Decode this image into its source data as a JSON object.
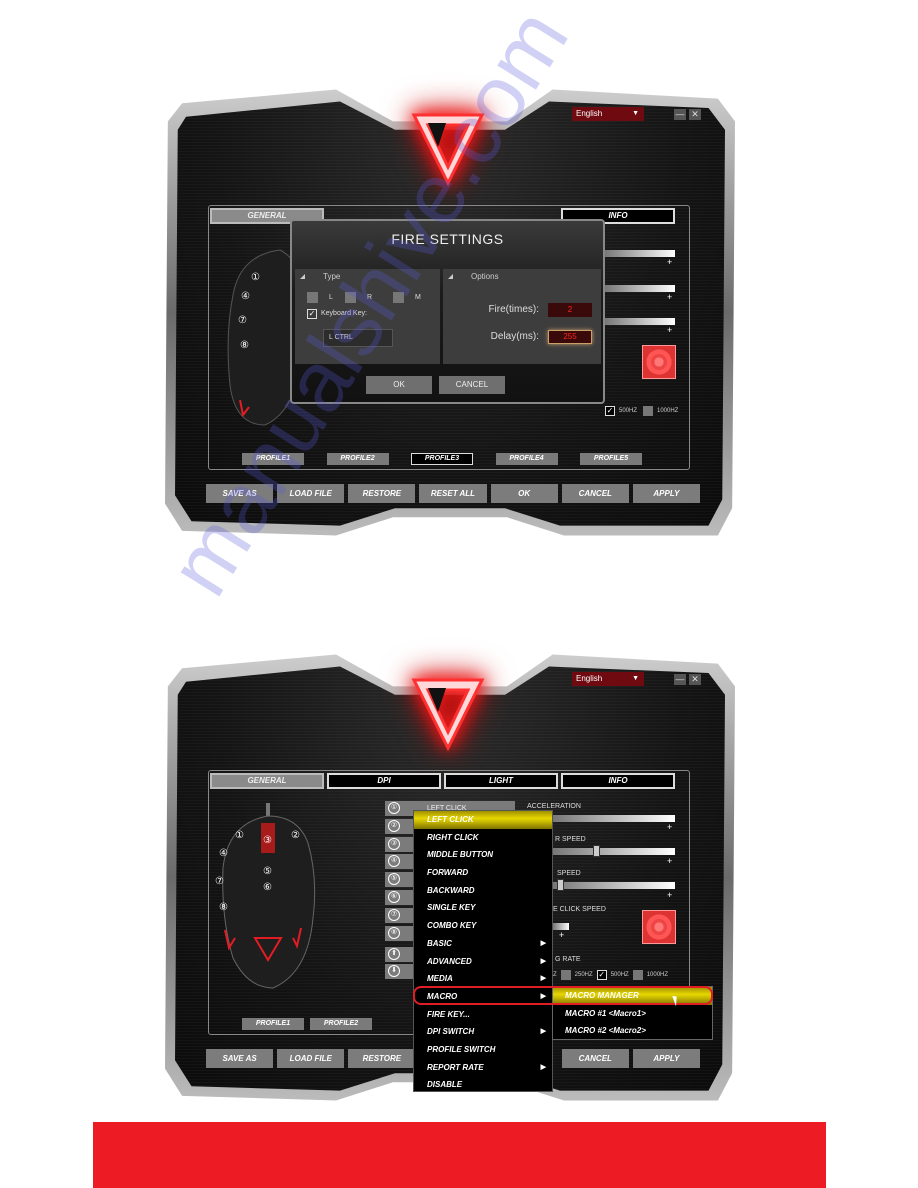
{
  "colors": {
    "accent_red": "#ed1c24",
    "menu_highlight": "#e6d600",
    "language_bg": "#6e0a10",
    "field_text_red": "#ff2222"
  },
  "watermark": "manualshive.com",
  "screenshot_top": {
    "language": "English",
    "window_controls": {
      "minimize": "—",
      "close": "✕"
    },
    "tabs": [
      {
        "label": "GENERAL",
        "active": true
      },
      {
        "label": "INFO",
        "active": false
      }
    ],
    "mouse_buttons_visible": [
      "①",
      "④",
      "⑦",
      "⑧"
    ],
    "fire_settings": {
      "title": "FIRE SETTINGS",
      "type_panel": {
        "header": "Type",
        "options": [
          {
            "label": "L",
            "checked": false
          },
          {
            "label": "R",
            "checked": false
          },
          {
            "label": "M",
            "checked": false
          }
        ],
        "keyboard_key_label": "Keyboard Key:",
        "keyboard_key_checked": true,
        "keyboard_key_value": "L CTRL"
      },
      "options_panel": {
        "header": "Options",
        "fire_times_label": "Fire(times):",
        "fire_times_value": "2",
        "delay_label": "Delay(ms):",
        "delay_value": "255"
      },
      "ok_label": "OK",
      "cancel_label": "CANCEL"
    },
    "report_rate": [
      {
        "label": "500HZ",
        "checked": true
      },
      {
        "label": "1000HZ",
        "checked": false
      }
    ],
    "profiles": [
      {
        "label": "PROFILE1",
        "active": false
      },
      {
        "label": "PROFILE2",
        "active": false
      },
      {
        "label": "PROFILE3",
        "active": true
      },
      {
        "label": "PROFILE4",
        "active": false
      },
      {
        "label": "PROFILE5",
        "active": false
      }
    ],
    "actions": [
      "SAVE AS",
      "LOAD FILE",
      "RESTORE",
      "RESET ALL",
      "OK",
      "CANCEL",
      "APPLY"
    ]
  },
  "screenshot_bottom": {
    "language": "English",
    "window_controls": {
      "minimize": "—",
      "close": "✕"
    },
    "tabs": [
      {
        "label": "GENERAL",
        "active": true
      },
      {
        "label": "DPI",
        "active": false
      },
      {
        "label": "LIGHT",
        "active": false
      },
      {
        "label": "INFO",
        "active": false
      }
    ],
    "mouse_labels": [
      "①",
      "②",
      "③",
      "④",
      "⑤",
      "⑥",
      "⑦",
      "⑧"
    ],
    "button_list": [
      {
        "num": "①",
        "label": "LEFT CLICK"
      },
      {
        "num": "②",
        "label": ""
      },
      {
        "num": "③",
        "label": ""
      },
      {
        "num": "④",
        "label": ""
      },
      {
        "num": "⑤",
        "label": ""
      },
      {
        "num": "⑥",
        "label": ""
      },
      {
        "num": "⑦",
        "label": ""
      },
      {
        "num": "⑧",
        "label": ""
      },
      {
        "num": "⬆",
        "label": ""
      },
      {
        "num": "⬇",
        "label": ""
      }
    ],
    "settings": {
      "acceleration_label": "ACCELERATION",
      "pointer_speed_label": "R SPEED",
      "scroll_speed_label": "SPEED",
      "double_click_label": "E CLICK SPEED",
      "report_rate_label": "G RATE",
      "pointer_speed_value": 0.45,
      "scroll_speed_value": 0.05
    },
    "report_rate": [
      {
        "label": "Z",
        "checked": false
      },
      {
        "label": "250HZ",
        "checked": false
      },
      {
        "label": "500HZ",
        "checked": true
      },
      {
        "label": "1000HZ",
        "checked": false
      }
    ],
    "context_menu": [
      {
        "label": "LEFT CLICK",
        "highlighted": true,
        "submenu": false
      },
      {
        "label": "RIGHT CLICK",
        "highlighted": false,
        "submenu": false
      },
      {
        "label": "MIDDLE BUTTON",
        "highlighted": false,
        "submenu": false
      },
      {
        "label": "FORWARD",
        "highlighted": false,
        "submenu": false
      },
      {
        "label": "BACKWARD",
        "highlighted": false,
        "submenu": false
      },
      {
        "label": "SINGLE KEY",
        "highlighted": false,
        "submenu": false
      },
      {
        "label": "COMBO KEY",
        "highlighted": false,
        "submenu": false
      },
      {
        "label": "BASIC",
        "highlighted": false,
        "submenu": true
      },
      {
        "label": "ADVANCED",
        "highlighted": false,
        "submenu": true
      },
      {
        "label": "MEDIA",
        "highlighted": false,
        "submenu": true
      },
      {
        "label": "MACRO",
        "highlighted": false,
        "submenu": true
      },
      {
        "label": "FIRE KEY...",
        "highlighted": false,
        "submenu": false
      },
      {
        "label": "DPI SWITCH",
        "highlighted": false,
        "submenu": true
      },
      {
        "label": "PROFILE SWITCH",
        "highlighted": false,
        "submenu": false
      },
      {
        "label": "REPORT RATE",
        "highlighted": false,
        "submenu": true
      },
      {
        "label": "DISABLE",
        "highlighted": false,
        "submenu": false
      }
    ],
    "macro_submenu": [
      {
        "label": "MACRO MANAGER",
        "highlighted": true
      },
      {
        "label": "MACRO #1 <Macro1>",
        "highlighted": false
      },
      {
        "label": "MACRO #2 <Macro2>",
        "highlighted": false
      }
    ],
    "profiles": [
      {
        "label": "PROFILE1",
        "active": false
      },
      {
        "label": "PROFILE2",
        "active": false
      }
    ],
    "actions": [
      "SAVE AS",
      "LOAD FILE",
      "RESTORE",
      "CANCEL",
      "APPLY"
    ]
  }
}
